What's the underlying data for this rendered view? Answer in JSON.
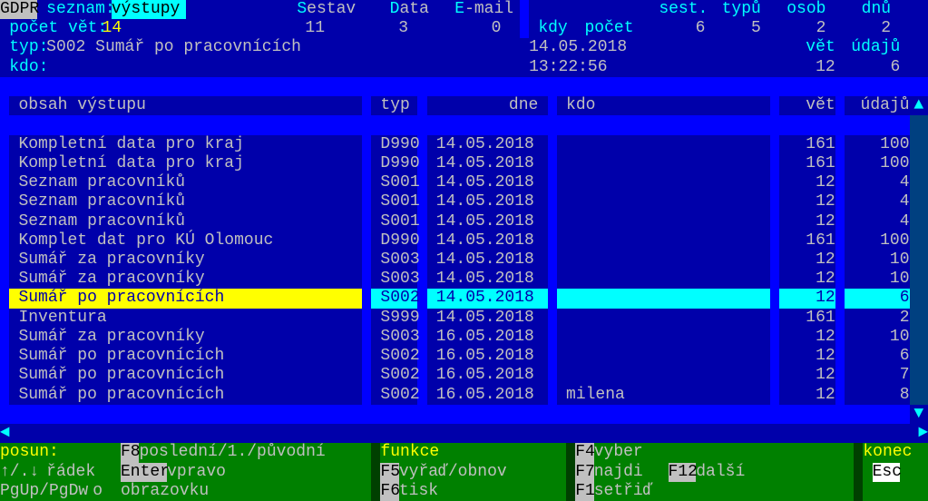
{
  "top": {
    "app": "GDPR",
    "seznam_label": "seznam:",
    "seznam_value": "výstupy",
    "menu_sestav": "Sestav",
    "menu_data": "Data",
    "menu_email": "E-mail",
    "sest_label": "sest.",
    "sest_value": "6",
    "typu_label": "typů",
    "typu_value": "5",
    "osob_label": "osob",
    "osob_value": "2",
    "dnu_label": "dnů",
    "dnu_value": "2",
    "pocet_label": "počet vět:",
    "pocet_value": "14",
    "col11": "11",
    "col3": "3",
    "col0": "0",
    "kdy_label": "kdy",
    "pocet2_label": "počet",
    "typ_label": "typ:",
    "typ_value": "S002 Sumář po pracovnících",
    "date": "14.05.2018",
    "time": "13:22:56",
    "vet_label": "vět",
    "vet_value": "12",
    "udaju_label": "údajů",
    "udaju_value": "6",
    "kdo_label": "kdo:"
  },
  "headers": {
    "obsah": "obsah výstupu",
    "typ": "typ",
    "dne": "dne",
    "kdo": "kdo",
    "vet": "vět",
    "udaju": "údajů"
  },
  "rows": [
    {
      "obsah": "Kompletní data pro kraj",
      "typ": "D990",
      "dne": "14.05.2018",
      "kdo": "",
      "vet": "161",
      "udaju": "100",
      "sel": false
    },
    {
      "obsah": "Kompletní data pro kraj",
      "typ": "D990",
      "dne": "14.05.2018",
      "kdo": "",
      "vet": "161",
      "udaju": "100",
      "sel": false
    },
    {
      "obsah": "Seznam pracovníků",
      "typ": "S001",
      "dne": "14.05.2018",
      "kdo": "",
      "vet": "12",
      "udaju": "4",
      "sel": false
    },
    {
      "obsah": "Seznam pracovníků",
      "typ": "S001",
      "dne": "14.05.2018",
      "kdo": "",
      "vet": "12",
      "udaju": "4",
      "sel": false
    },
    {
      "obsah": "Seznam pracovníků",
      "typ": "S001",
      "dne": "14.05.2018",
      "kdo": "",
      "vet": "12",
      "udaju": "4",
      "sel": false
    },
    {
      "obsah": "Komplet dat pro KÚ Olomouc",
      "typ": "D990",
      "dne": "14.05.2018",
      "kdo": "",
      "vet": "161",
      "udaju": "100",
      "sel": false
    },
    {
      "obsah": "Sumář za pracovníky",
      "typ": "S003",
      "dne": "14.05.2018",
      "kdo": "",
      "vet": "12",
      "udaju": "10",
      "sel": false
    },
    {
      "obsah": "Sumář za pracovníky",
      "typ": "S003",
      "dne": "14.05.2018",
      "kdo": "",
      "vet": "12",
      "udaju": "10",
      "sel": false
    },
    {
      "obsah": "Sumář po pracovnících",
      "typ": "S002",
      "dne": "14.05.2018",
      "kdo": "",
      "vet": "12",
      "udaju": "6",
      "sel": true
    },
    {
      "obsah": "Inventura",
      "typ": "S999",
      "dne": "14.05.2018",
      "kdo": "",
      "vet": "161",
      "udaju": "2",
      "sel": false
    },
    {
      "obsah": "Sumář za pracovníky",
      "typ": "S003",
      "dne": "16.05.2018",
      "kdo": "",
      "vet": "12",
      "udaju": "10",
      "sel": false
    },
    {
      "obsah": "Sumář po pracovnících",
      "typ": "S002",
      "dne": "16.05.2018",
      "kdo": "",
      "vet": "12",
      "udaju": "6",
      "sel": false
    },
    {
      "obsah": "Sumář po pracovnících",
      "typ": "S002",
      "dne": "16.05.2018",
      "kdo": "",
      "vet": "12",
      "udaju": "7",
      "sel": false
    },
    {
      "obsah": "Sumář po pracovnících",
      "typ": "S002",
      "dne": "16.05.2018",
      "kdo": "milena",
      "vet": "12",
      "udaju": "8",
      "sel": false
    }
  ],
  "footer": {
    "posun": "posun:",
    "f8": "F8",
    "f8t": "poslední/1./původní",
    "arrows": "↑/.↓",
    "radek": "řádek",
    "enter": "Enter",
    "vpravo": "vpravo",
    "pg": "PgUp/PgDw",
    "o": "o",
    "obraz": "obrazovku",
    "funkce": "funkce",
    "f5": "F5",
    "f5t": "vyřaď/obnov",
    "f6": "F6",
    "f6t": "tisk",
    "f4": "F4",
    "f4t": "vyber",
    "f7": "F7",
    "f7t": "najdi",
    "f12": "F12",
    "f12t": "další",
    "f1": "F1",
    "f1t": "setřiď",
    "konec": "konec",
    "esc": "Esc"
  }
}
